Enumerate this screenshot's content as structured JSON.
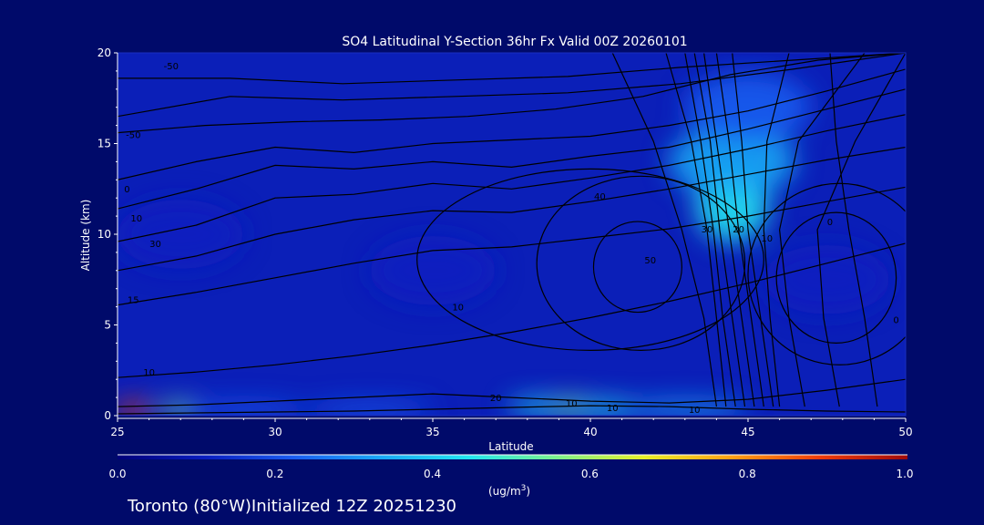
{
  "chart_data": {
    "type": "heatmap",
    "title": "SO4 Latitudinal Y-Section 36hr  Fx Valid 00Z 20260101",
    "xlabel": "Latitude",
    "ylabel": "Altitude (km)",
    "xlim": [
      25,
      50
    ],
    "ylim": [
      0,
      20
    ],
    "x_ticks": [
      "25",
      "30",
      "35",
      "40",
      "45",
      "50"
    ],
    "y_ticks": [
      "0",
      "5",
      "10",
      "15",
      "20"
    ],
    "grid": false,
    "colorbar": {
      "ticks": [
        "0.0",
        "0.2",
        "0.4",
        "0.6",
        "0.8",
        "1.0"
      ],
      "range": [
        0.0,
        1.0
      ],
      "units_base": "(ug/m",
      "units_sup": "3",
      "units_close": ")",
      "colors": [
        "#00007a",
        "#0a1ec0",
        "#1a5cf0",
        "#19a8f5",
        "#21e6f0",
        "#7cf28c",
        "#e8f028",
        "#ffa014",
        "#f03c0a",
        "#a00a0a"
      ]
    },
    "background": "#000a6a",
    "field_samples": [
      {
        "lat": 25.5,
        "alt": 0.3,
        "value": 0.85
      },
      {
        "lat": 27,
        "alt": 0.3,
        "value": 0.55
      },
      {
        "lat": 29,
        "alt": 0.3,
        "value": 0.25
      },
      {
        "lat": 33,
        "alt": 0.3,
        "value": 0.2
      },
      {
        "lat": 38.5,
        "alt": 0.5,
        "value": 0.45
      },
      {
        "lat": 39.5,
        "alt": 0.5,
        "value": 0.55
      },
      {
        "lat": 40.5,
        "alt": 0.4,
        "value": 0.4
      },
      {
        "lat": 43,
        "alt": 0.4,
        "value": 0.3
      },
      {
        "lat": 44.5,
        "alt": 11.5,
        "value": 0.4
      },
      {
        "lat": 44.5,
        "alt": 14,
        "value": 0.3
      },
      {
        "lat": 45,
        "alt": 17,
        "value": 0.2
      },
      {
        "lat": 35,
        "alt": 8,
        "value": 0.1
      },
      {
        "lat": 27,
        "alt": 10,
        "value": 0.12
      },
      {
        "lat": 47.5,
        "alt": 7.5,
        "value": 0.08
      }
    ],
    "contour_labels": [
      {
        "text": "-50",
        "lat": 26.7,
        "alt": 19.1
      },
      {
        "text": "-50",
        "lat": 25.5,
        "alt": 15.3
      },
      {
        "text": "0",
        "lat": 25.3,
        "alt": 12.3
      },
      {
        "text": "10",
        "lat": 25.6,
        "alt": 10.7
      },
      {
        "text": "30",
        "lat": 26.2,
        "alt": 9.3
      },
      {
        "text": "15",
        "lat": 25.5,
        "alt": 6.2
      },
      {
        "text": "10",
        "lat": 26.0,
        "alt": 2.2
      },
      {
        "text": "10",
        "lat": 35.8,
        "alt": 5.8
      },
      {
        "text": "20",
        "lat": 37.0,
        "alt": 0.8
      },
      {
        "text": "10",
        "lat": 39.4,
        "alt": 0.5
      },
      {
        "text": "10",
        "lat": 40.7,
        "alt": 0.25
      },
      {
        "text": "10",
        "lat": 43.3,
        "alt": 0.15
      },
      {
        "text": "40",
        "lat": 40.3,
        "alt": 11.9
      },
      {
        "text": "50",
        "lat": 41.9,
        "alt": 8.4
      },
      {
        "text": "30",
        "lat": 43.7,
        "alt": 10.1
      },
      {
        "text": "20",
        "lat": 44.7,
        "alt": 10.1
      },
      {
        "text": "10",
        "lat": 45.6,
        "alt": 9.6
      },
      {
        "text": "0",
        "lat": 47.6,
        "alt": 10.5
      },
      {
        "text": "0",
        "lat": 49.7,
        "alt": 5.1
      }
    ],
    "contours": [
      {
        "alts": [
          18.6,
          18.6,
          18.3,
          18.5,
          18.7,
          19.2,
          19.6,
          20
        ]
      },
      {
        "alts": [
          16.5,
          17.6,
          17.4,
          17.6,
          17.8,
          18.3,
          19.1,
          20
        ]
      },
      {
        "alts": [
          15.6,
          16.0,
          16.2,
          16.3,
          16.5,
          16.9,
          17.6,
          18.8,
          19.6,
          20
        ]
      },
      {
        "alts": [
          13.0,
          14.0,
          14.8,
          14.5,
          15.0,
          15.2,
          15.4,
          16.0,
          16.8,
          17.9,
          19.1
        ]
      },
      {
        "alts": [
          11.4,
          12.5,
          13.8,
          13.6,
          14.0,
          13.7,
          14.3,
          14.8,
          15.8,
          16.9,
          18.0
        ]
      },
      {
        "alts": [
          9.6,
          10.5,
          12.0,
          12.2,
          12.8,
          12.5,
          13.1,
          13.8,
          14.7,
          15.7,
          16.6
        ]
      },
      {
        "alts": [
          8.0,
          8.8,
          10.0,
          10.8,
          11.3,
          11.2,
          11.8,
          12.5,
          13.3,
          14.1,
          14.8
        ]
      },
      {
        "alts": [
          6.1,
          6.8,
          7.6,
          8.4,
          9.1,
          9.3,
          9.8,
          10.3,
          11.0,
          11.8,
          12.6
        ]
      },
      {
        "alts": [
          2.1,
          2.4,
          2.8,
          3.3,
          3.9,
          4.6,
          5.4,
          6.3,
          7.3,
          8.4,
          9.5
        ]
      },
      {
        "alts": [
          0.5,
          0.6,
          0.8,
          1.0,
          1.2,
          1.0,
          0.8,
          0.7,
          0.9,
          1.4,
          2.0
        ]
      },
      {
        "alts": [
          0.1,
          0.15,
          0.2,
          0.25,
          0.35,
          0.45,
          0.55,
          0.5,
          0.35,
          0.25,
          0.2
        ]
      }
    ],
    "tall_contours": [
      {
        "lats": [
          40.7,
          42.0,
          42.9,
          43.6,
          44.0
        ]
      },
      {
        "lats": [
          42.4,
          43.2,
          43.7,
          44.0,
          44.3
        ]
      },
      {
        "lats": [
          43.0,
          43.5,
          43.9,
          44.2,
          44.6
        ]
      },
      {
        "lats": [
          43.3,
          43.8,
          44.1,
          44.5,
          44.9
        ]
      },
      {
        "lats": [
          43.6,
          44.0,
          44.4,
          44.8,
          45.2
        ]
      },
      {
        "lats": [
          44.0,
          44.4,
          44.7,
          45.1,
          45.5
        ]
      },
      {
        "lats": [
          44.5,
          44.8,
          45.0,
          45.4,
          45.8
        ]
      },
      {
        "lats": [
          46.3,
          45.6,
          45.5,
          45.7,
          46.0
        ]
      },
      {
        "lats": [
          48.7,
          46.6,
          46.0,
          46.3,
          46.8
        ]
      },
      {
        "lats": [
          50.0,
          48.4,
          47.2,
          47.4,
          47.9
        ]
      },
      {
        "lats": [
          47.6,
          47.8,
          48.2,
          48.7,
          49.1
        ]
      }
    ],
    "closed_contours": [
      {
        "center": [
          41.5,
          8.2
        ],
        "radius": [
          1.4,
          2.5
        ]
      },
      {
        "center": [
          41.6,
          8.4
        ],
        "radius": [
          3.3,
          4.8
        ]
      },
      {
        "center": [
          40.0,
          8.6
        ],
        "radius": [
          5.5,
          5.0
        ]
      },
      {
        "center": [
          47.8,
          7.6
        ],
        "radius": [
          1.9,
          3.6
        ]
      },
      {
        "center": [
          47.9,
          7.8
        ],
        "radius": [
          2.9,
          5.0
        ]
      }
    ]
  },
  "footer": {
    "location": "Toronto (80°W)Initialized 12Z 20251230"
  }
}
